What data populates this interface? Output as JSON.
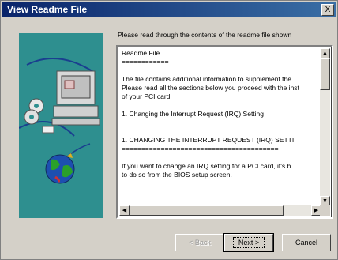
{
  "window": {
    "title": "View Readme File",
    "close_label": "X"
  },
  "instruction": "Please read through the contents of the readme file shown",
  "readme": {
    "lines": [
      "Readme File",
      "============",
      "",
      "The file contains additional information to supplement the ...",
      "Please read all the sections below you proceed with the inst",
      "of your PCI card.",
      "",
      "   1.  Changing the Interrupt Request (IRQ) Setting",
      "",
      "",
      "1. CHANGING THE INTERRUPT REQUEST (IRQ) SETTI",
      "========================================",
      "",
      "If you want to change an IRQ setting for a PCI card, it's b",
      "to do so from the BIOS setup screen."
    ]
  },
  "scroll": {
    "up": "▲",
    "down": "▼",
    "left": "◀",
    "right": "▶"
  },
  "buttons": {
    "back": "< Back",
    "next": "Next >",
    "cancel": "Cancel"
  },
  "colors": {
    "art_background": "#2e8f8f",
    "titlebar": "#0a246a"
  }
}
